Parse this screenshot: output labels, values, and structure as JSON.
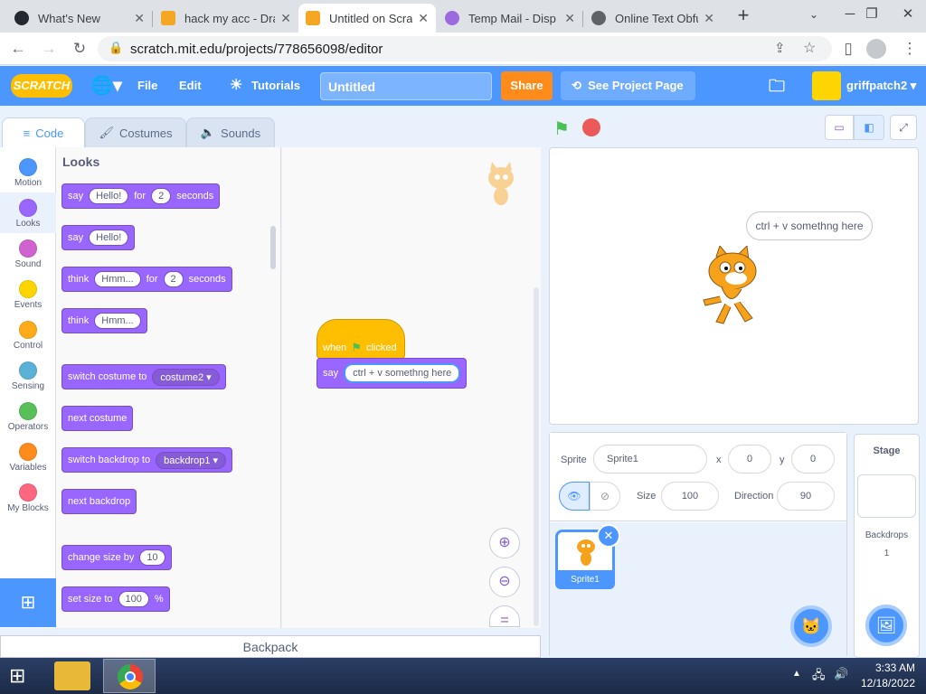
{
  "browser": {
    "tabs": [
      {
        "title": "What's New",
        "icon": "github-icon",
        "color": "#24292f",
        "active": false
      },
      {
        "title": "hack my acc - Dra",
        "icon": "doc-icon",
        "color": "#f5a623",
        "active": false
      },
      {
        "title": "Untitled on Scratc",
        "icon": "scratch-icon",
        "color": "#f5a623",
        "active": true
      },
      {
        "title": "Temp Mail - Disp",
        "icon": "mail-icon",
        "color": "#9c6ade",
        "active": false
      },
      {
        "title": "Online Text Obfu",
        "icon": "globe-icon",
        "color": "#5f6368",
        "active": false
      }
    ],
    "url": "scratch.mit.edu/projects/778656098/editor"
  },
  "menu": {
    "logo": "SCRATCH",
    "file": "File",
    "edit": "Edit",
    "tutorials": "Tutorials",
    "title_value": "Untitled",
    "share": "Share",
    "see_project": "See Project Page",
    "username": "griffpatch2"
  },
  "editor_tabs": {
    "code": "Code",
    "costumes": "Costumes",
    "sounds": "Sounds"
  },
  "categories": [
    {
      "label": "Motion",
      "color": "#4c97ff"
    },
    {
      "label": "Looks",
      "color": "#9966ff"
    },
    {
      "label": "Sound",
      "color": "#cf63cf"
    },
    {
      "label": "Events",
      "color": "#ffd500"
    },
    {
      "label": "Control",
      "color": "#ffab19"
    },
    {
      "label": "Sensing",
      "color": "#5cb1d6"
    },
    {
      "label": "Operators",
      "color": "#59c059"
    },
    {
      "label": "Variables",
      "color": "#ff8c1a"
    },
    {
      "label": "My Blocks",
      "color": "#ff6680"
    }
  ],
  "palette": {
    "heading": "Looks",
    "b1": {
      "a": "say",
      "v": "Hello!",
      "b": "for",
      "n": "2",
      "c": "seconds"
    },
    "b2": {
      "a": "say",
      "v": "Hello!"
    },
    "b3": {
      "a": "think",
      "v": "Hmm...",
      "b": "for",
      "n": "2",
      "c": "seconds"
    },
    "b4": {
      "a": "think",
      "v": "Hmm..."
    },
    "b5": {
      "a": "switch costume to",
      "v": "costume2"
    },
    "b6": {
      "a": "next costume"
    },
    "b7": {
      "a": "switch backdrop to",
      "v": "backdrop1"
    },
    "b8": {
      "a": "next backdrop"
    },
    "b9": {
      "a": "change size by",
      "v": "10"
    },
    "b10": {
      "a": "set size to",
      "v": "100",
      "c": "%"
    }
  },
  "script": {
    "when": "when",
    "clicked": "clicked",
    "say": "say",
    "say_value": "ctrl + v somethng here"
  },
  "stage": {
    "bubble": "ctrl + v somethng here"
  },
  "sprite": {
    "label": "Sprite",
    "name": "Sprite1",
    "x_label": "x",
    "x": "0",
    "y_label": "y",
    "y": "0",
    "show_label": "Show",
    "size_label": "Size",
    "size": "100",
    "direction_label": "Direction",
    "direction": "90",
    "thumb_name": "Sprite1"
  },
  "stage_panel": {
    "title": "Stage",
    "backdrops_label": "Backdrops",
    "backdrops_count": "1"
  },
  "backpack": "Backpack",
  "taskbar": {
    "time": "3:33 AM",
    "date": "12/18/2022"
  }
}
